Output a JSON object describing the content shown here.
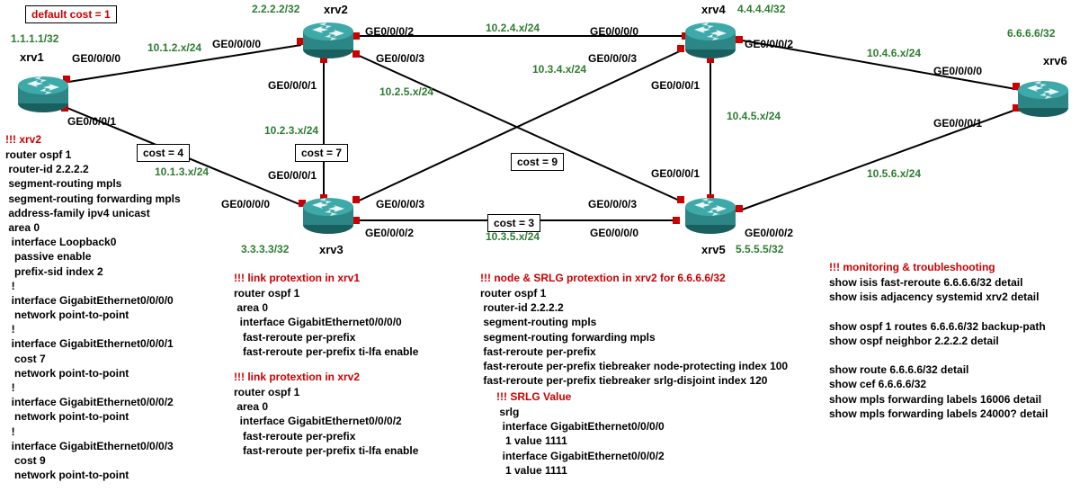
{
  "defaultCost": "default cost = 1",
  "routers": {
    "xrv1": {
      "name": "xrv1",
      "addr": "1.1.1.1/32"
    },
    "xrv2": {
      "name": "xrv2",
      "addr": "2.2.2.2/32"
    },
    "xrv3": {
      "name": "xrv3",
      "addr": "3.3.3.3/32"
    },
    "xrv4": {
      "name": "xrv4",
      "addr": "4.4.4.4/32"
    },
    "xrv5": {
      "name": "xrv5",
      "addr": "5.5.5.5/32"
    },
    "xrv6": {
      "name": "xrv6",
      "addr": "6.6.6.6/32"
    }
  },
  "ifaces": {
    "x1_000": "GE0/0/0/0",
    "x1_001": "GE0/0/0/1",
    "x2_000": "GE0/0/0/0",
    "x2_001": "GE0/0/0/1",
    "x2_002": "GE0/0/0/2",
    "x2_003": "GE0/0/0/3",
    "x3_000": "GE0/0/0/0",
    "x3_001": "GE0/0/0/1",
    "x3_002": "GE0/0/0/2",
    "x3_003": "GE0/0/0/3",
    "x4_000": "GE0/0/0/0",
    "x4_001": "GE0/0/0/1",
    "x4_002": "GE0/0/0/2",
    "x4_003": "GE0/0/0/3",
    "x5_000": "GE0/0/0/0",
    "x5_001": "GE0/0/0/1",
    "x5_002": "GE0/0/0/2",
    "x5_003": "GE0/0/0/3",
    "x6_000": "GE0/0/0/0",
    "x6_001": "GE0/0/0/1"
  },
  "subnets": {
    "s1012": "10.1.2.x/24",
    "s1013": "10.1.3.x/24",
    "s1023": "10.2.3.x/24",
    "s1024": "10.2.4.x/24",
    "s1025": "10.2.5.x/24",
    "s1034": "10.3.4.x/24",
    "s1035": "10.3.5.x/24",
    "s1045": "10.4.5.x/24",
    "s1046": "10.4.6.x/24",
    "s1056": "10.5.6.x/24"
  },
  "costs": {
    "c4": "cost = 4",
    "c7": "cost = 7",
    "c9": "cost = 9",
    "c3": "cost = 3"
  },
  "cfg_xrv2_hdr": "!!! xrv2",
  "cfg_xrv2": "router ospf 1\n router-id 2.2.2.2\n segment-routing mpls\n segment-routing forwarding mpls\n address-family ipv4 unicast\n area 0\n  interface Loopback0\n   passive enable\n   prefix-sid index 2\n  !\n  interface GigabitEthernet0/0/0/0\n   network point-to-point\n  !\n  interface GigabitEthernet0/0/0/1\n   cost 7\n   network point-to-point\n  !\n  interface GigabitEthernet0/0/0/2\n   network point-to-point\n  !\n  interface GigabitEthernet0/0/0/3\n   cost 9\n   network point-to-point",
  "cfg_link1_hdr": "!!! link protextion in xrv1",
  "cfg_link1": "router ospf 1\n area 0\n  interface GigabitEthernet0/0/0/0\n   fast-reroute per-prefix\n   fast-reroute per-prefix ti-lfa enable",
  "cfg_link2_hdr": "!!! link protextion in xrv2",
  "cfg_link2": "router ospf 1\n area 0\n  interface GigabitEthernet0/0/0/2\n   fast-reroute per-prefix\n   fast-reroute per-prefix ti-lfa enable",
  "cfg_node_hdr": "!!! node & SRLG protextion in xrv2 for 6.6.6.6/32",
  "cfg_node": "router ospf 1\n router-id 2.2.2.2\n segment-routing mpls\n segment-routing forwarding mpls\n fast-reroute per-prefix\n fast-reroute per-prefix tiebreaker node-protecting index 100\n fast-reroute per-prefix tiebreaker srlg-disjoint index 120",
  "cfg_srlg_hdr": "!!! SRLG Value",
  "cfg_srlg": " srlg\n  interface GigabitEthernet0/0/0/0\n   1 value 1111\n  interface GigabitEthernet0/0/0/2\n   1 value 1111",
  "cfg_mon_hdr": "!!! monitoring & troubleshooting",
  "cfg_mon": "show isis fast-reroute 6.6.6.6/32 detail\nshow isis adjacency systemid xrv2 detail\n\nshow ospf 1 routes 6.6.6.6/32 backup-path\nshow ospf neighbor 2.2.2.2 detail\n\nshow route 6.6.6.6/32 detail\nshow cef 6.6.6.6/32\nshow mpls forwarding labels 16006 detail\nshow mpls forwarding labels 24000? detail"
}
